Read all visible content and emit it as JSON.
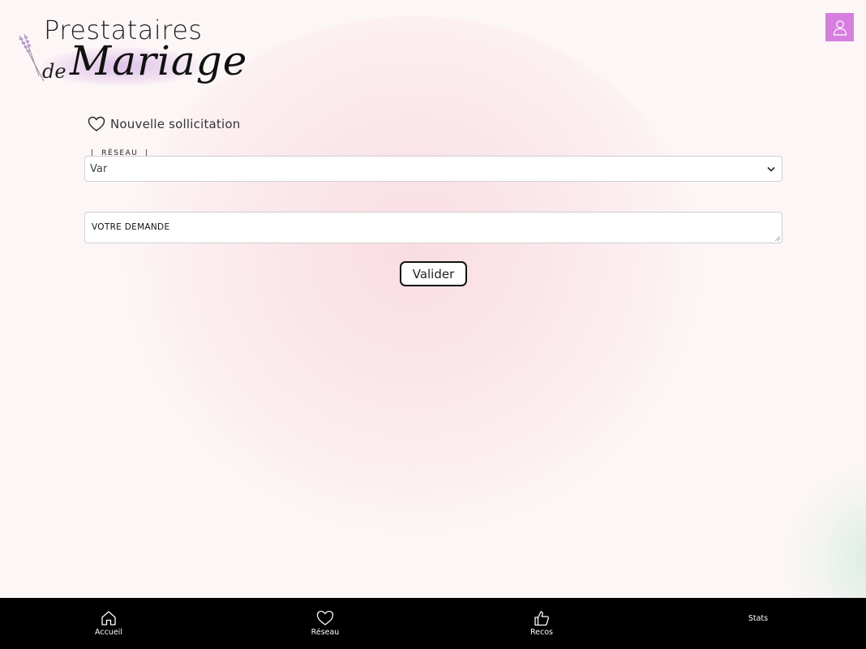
{
  "logo": {
    "line1": "Prestataires",
    "de": "de",
    "mariage": "Mariage"
  },
  "header": {
    "profile_icon": "user-icon",
    "accent_color": "#d67fe0"
  },
  "main": {
    "heading_icon": "heart-icon",
    "heading": "Nouvelle sollicitation",
    "network_field": {
      "legend": "RÉSEAU",
      "selected_value": "Var"
    },
    "request_field": {
      "placeholder": "VOTRE DEMANDE",
      "value": ""
    },
    "submit_label": "Valider"
  },
  "bottom_nav": {
    "items": [
      {
        "label": "Accueil",
        "icon": "home-icon"
      },
      {
        "label": "Réseau",
        "icon": "heart-icon"
      },
      {
        "label": "Recos",
        "icon": "thumbs-up-icon"
      },
      {
        "label": "Stats",
        "icon": ""
      }
    ]
  }
}
